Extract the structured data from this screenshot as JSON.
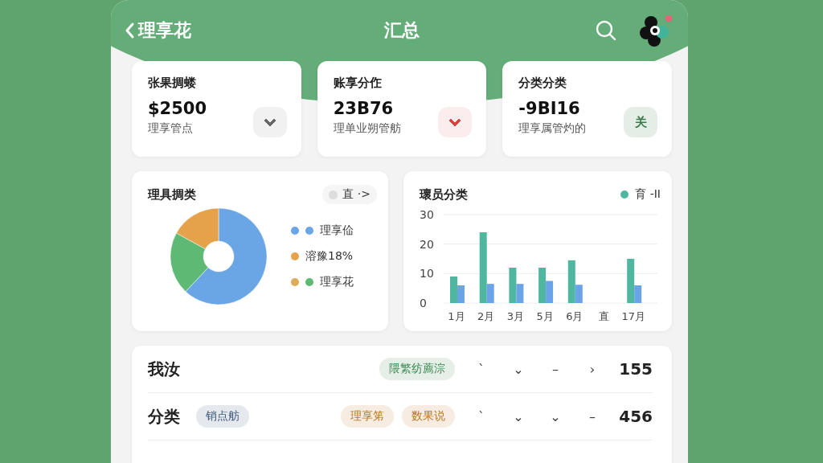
{
  "header": {
    "back_label": "理享花",
    "title": "汇总"
  },
  "stat_cards": [
    {
      "title": "张果㨄蝼",
      "value": "$2500",
      "subtitle": "理享管点",
      "button": {
        "kind": "chevron",
        "color": "#666666"
      }
    },
    {
      "title": "账享分㑅",
      "value": "23Β76",
      "subtitle": "理单业朔管舫",
      "button": {
        "kind": "chevron",
        "color": "#d9443c"
      }
    },
    {
      "title": "分类分类",
      "value": "-9BI16",
      "subtitle": "理享属管灼的",
      "button": {
        "kind": "text",
        "color": "#3d7a4c",
        "label": "关"
      }
    }
  ],
  "pie_card": {
    "title": "理具㨄类",
    "chip": "直 ·>",
    "legend": [
      {
        "dots": [
          {
            "color": "#6aa6e6"
          },
          {
            "color": "#6aa6e6"
          }
        ]
      },
      {
        "dots": [
          {
            "color": "#e6a24a"
          }
        ]
      },
      {
        "dots": [
          {
            "color": "#dcad58"
          },
          {
            "color": "#5db974"
          }
        ]
      }
    ],
    "chart_data": {
      "type": "donut",
      "legend": "right",
      "categories": [
        "理享佡",
        "溶豫18%",
        "理享花"
      ],
      "series": [
        {
          "values": [
            62,
            17,
            21
          ]
        }
      ],
      "colors": [
        "#6aa6e6",
        "#e6a24a",
        "#5db974"
      ]
    }
  },
  "bar_card": {
    "title": "瓌员分类",
    "chart_data": {
      "type": "bar",
      "categories": [
        "1月",
        "2月",
        "3月",
        "5月",
        "6月",
        "直",
        "17月"
      ],
      "yticks": [
        0,
        10,
        20,
        30
      ],
      "ylim": [
        0,
        30
      ],
      "series": [
        {
          "name": "育 -II",
          "color": "#4fb6a0",
          "values": [
            9,
            24,
            12,
            12,
            14.5,
            null,
            15
          ]
        },
        {
          "color": "#6aa3e6",
          "values": [
            6,
            6.5,
            6.5,
            7.5,
            6.2,
            null,
            6
          ]
        }
      ]
    }
  },
  "rows": [
    {
      "label": "我汝",
      "tags": [
        {
          "text": "隈繁纺薦淙",
          "color": "#3d8a52"
        }
      ],
      "marks": [
        "ˋ",
        "⌄",
        "–",
        "›"
      ],
      "value": "155"
    },
    {
      "label": "分类",
      "tag": {
        "text": "销点舫",
        "color": "#3f5a7c"
      },
      "tags": [
        {
          "text": "理享笫",
          "color": "#b8741e"
        },
        {
          "text": "数果说",
          "color": "#b8741e"
        }
      ],
      "marks": [
        "ˋ",
        "⌄",
        "⌄",
        "–"
      ],
      "value": "456"
    }
  ]
}
